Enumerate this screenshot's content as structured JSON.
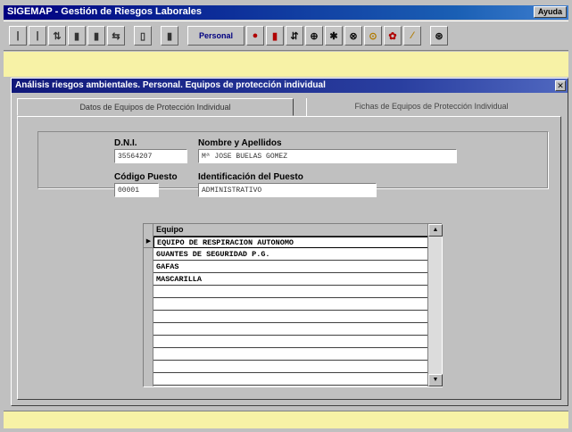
{
  "window": {
    "title": "SIGEMAP - Gestión de Riesgos Laborales",
    "title_btn": "Ayuda"
  },
  "toolbar": {
    "personal_label": "Personal",
    "buttons": [
      "|",
      "|",
      "⇅",
      "▮",
      "▮",
      "⇆",
      "▯",
      "▮",
      "●",
      "▮",
      "⇵",
      "⊕",
      "✱",
      "⊗",
      "⊙",
      "✿",
      "⁄",
      "⊛"
    ]
  },
  "child": {
    "title": "Análisis riesgos ambientales. Personal. Equipos de protección individual"
  },
  "tabs": [
    {
      "label": "Datos de Equipos de Protección Individual"
    },
    {
      "label": "Fichas de Equipos de Protección Individual"
    }
  ],
  "form": {
    "dni_label": "D.N.I.",
    "dni_value": "35564207",
    "name_label": "Nombre y Apellidos",
    "name_value": "Mª JOSE BUELAS GOMEZ",
    "codigo_label": "Código Puesto",
    "codigo_value": "00001",
    "ident_label": "Identificación del Puesto",
    "ident_value": "ADMINISTRATIVO"
  },
  "grid": {
    "column_header": "Equipo",
    "rows": [
      "EQUIPO DE RESPIRACION AUTONOMO",
      "GUANTES DE SEGURIDAD P.G.",
      "GAFAS",
      "MASCARILLA",
      "",
      "",
      "",
      "",
      "",
      "",
      "",
      ""
    ],
    "selected_indicator": "▶"
  },
  "colors": {
    "title_bar": "#000080",
    "yellow_band": "#f7f2a6",
    "window_bg": "#c0c0c0"
  }
}
